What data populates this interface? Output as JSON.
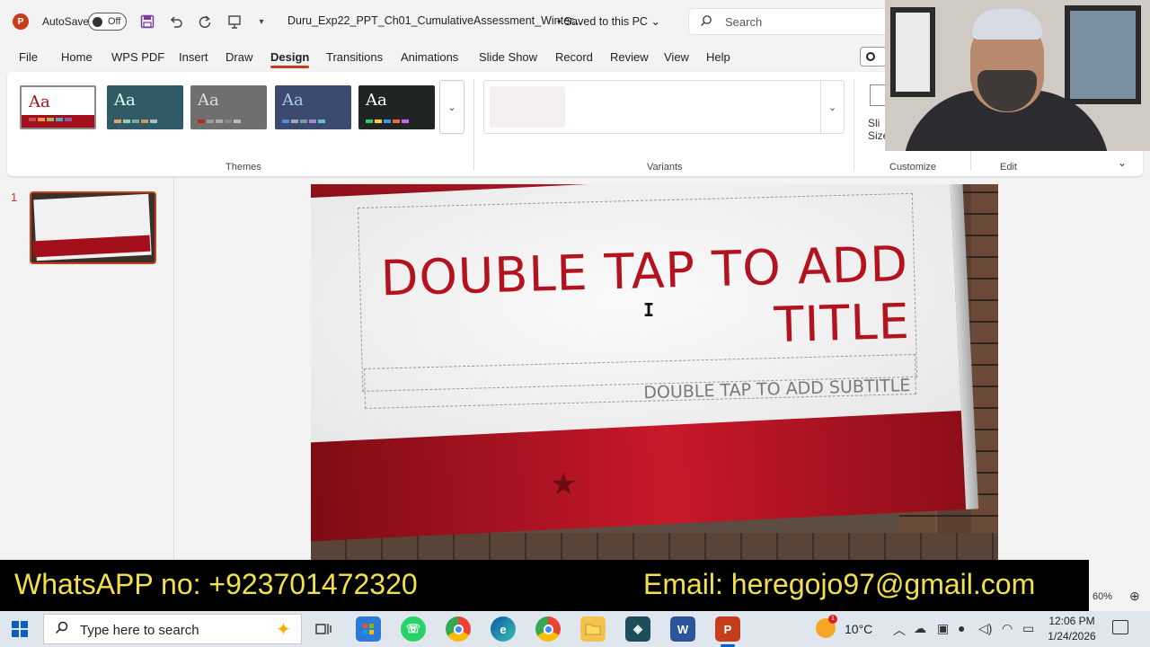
{
  "titlebar": {
    "autosave_label": "AutoSave",
    "autosave_state": "Off",
    "doc_title": "Duru_Exp22_PPT_Ch01_CumulativeAssessment_Winter...",
    "save_status": "• Saved to this PC",
    "search_placeholder": "Search"
  },
  "tabs": [
    "File",
    "Home",
    "WPS PDF",
    "Insert",
    "Draw",
    "Design",
    "Transitions",
    "Animations",
    "Slide Show",
    "Record",
    "Review",
    "View",
    "Help"
  ],
  "active_tab": "Design",
  "ribbon": {
    "themes_label": "Themes",
    "variants_label": "Variants",
    "customize_label": "Customize",
    "edit_label": "Edit",
    "slide_size_label_1": "Sli",
    "slide_size_label_2": "Size",
    "theme_aa": "Aa",
    "colors": {
      "theme1": "#ffffff",
      "theme2": "#2f5a66",
      "theme3": "#6f6f6f",
      "theme4": "#3c4a70",
      "theme5": "#202424",
      "accent": "#c43e1c"
    }
  },
  "thumbnails": {
    "slide_number": "1"
  },
  "slide": {
    "title_line1": "DOUBLE TAP TO ADD",
    "title_line2": "TITLE",
    "subtitle": "DOUBLE TAP TO ADD SUBTITLE",
    "title_color": "#b3121f"
  },
  "banner": {
    "whatsapp": "WhatsAPP no: +923701472320",
    "email": "Email: heregojo97@gmail.com",
    "text_color": "#f2e04a"
  },
  "statusbar": {
    "zoom": "60%"
  },
  "taskbar": {
    "search_placeholder": "Type here to search",
    "weather_badge": "1",
    "temperature": "10°C",
    "time": "12:06 PM",
    "date": "1/24/2026"
  }
}
